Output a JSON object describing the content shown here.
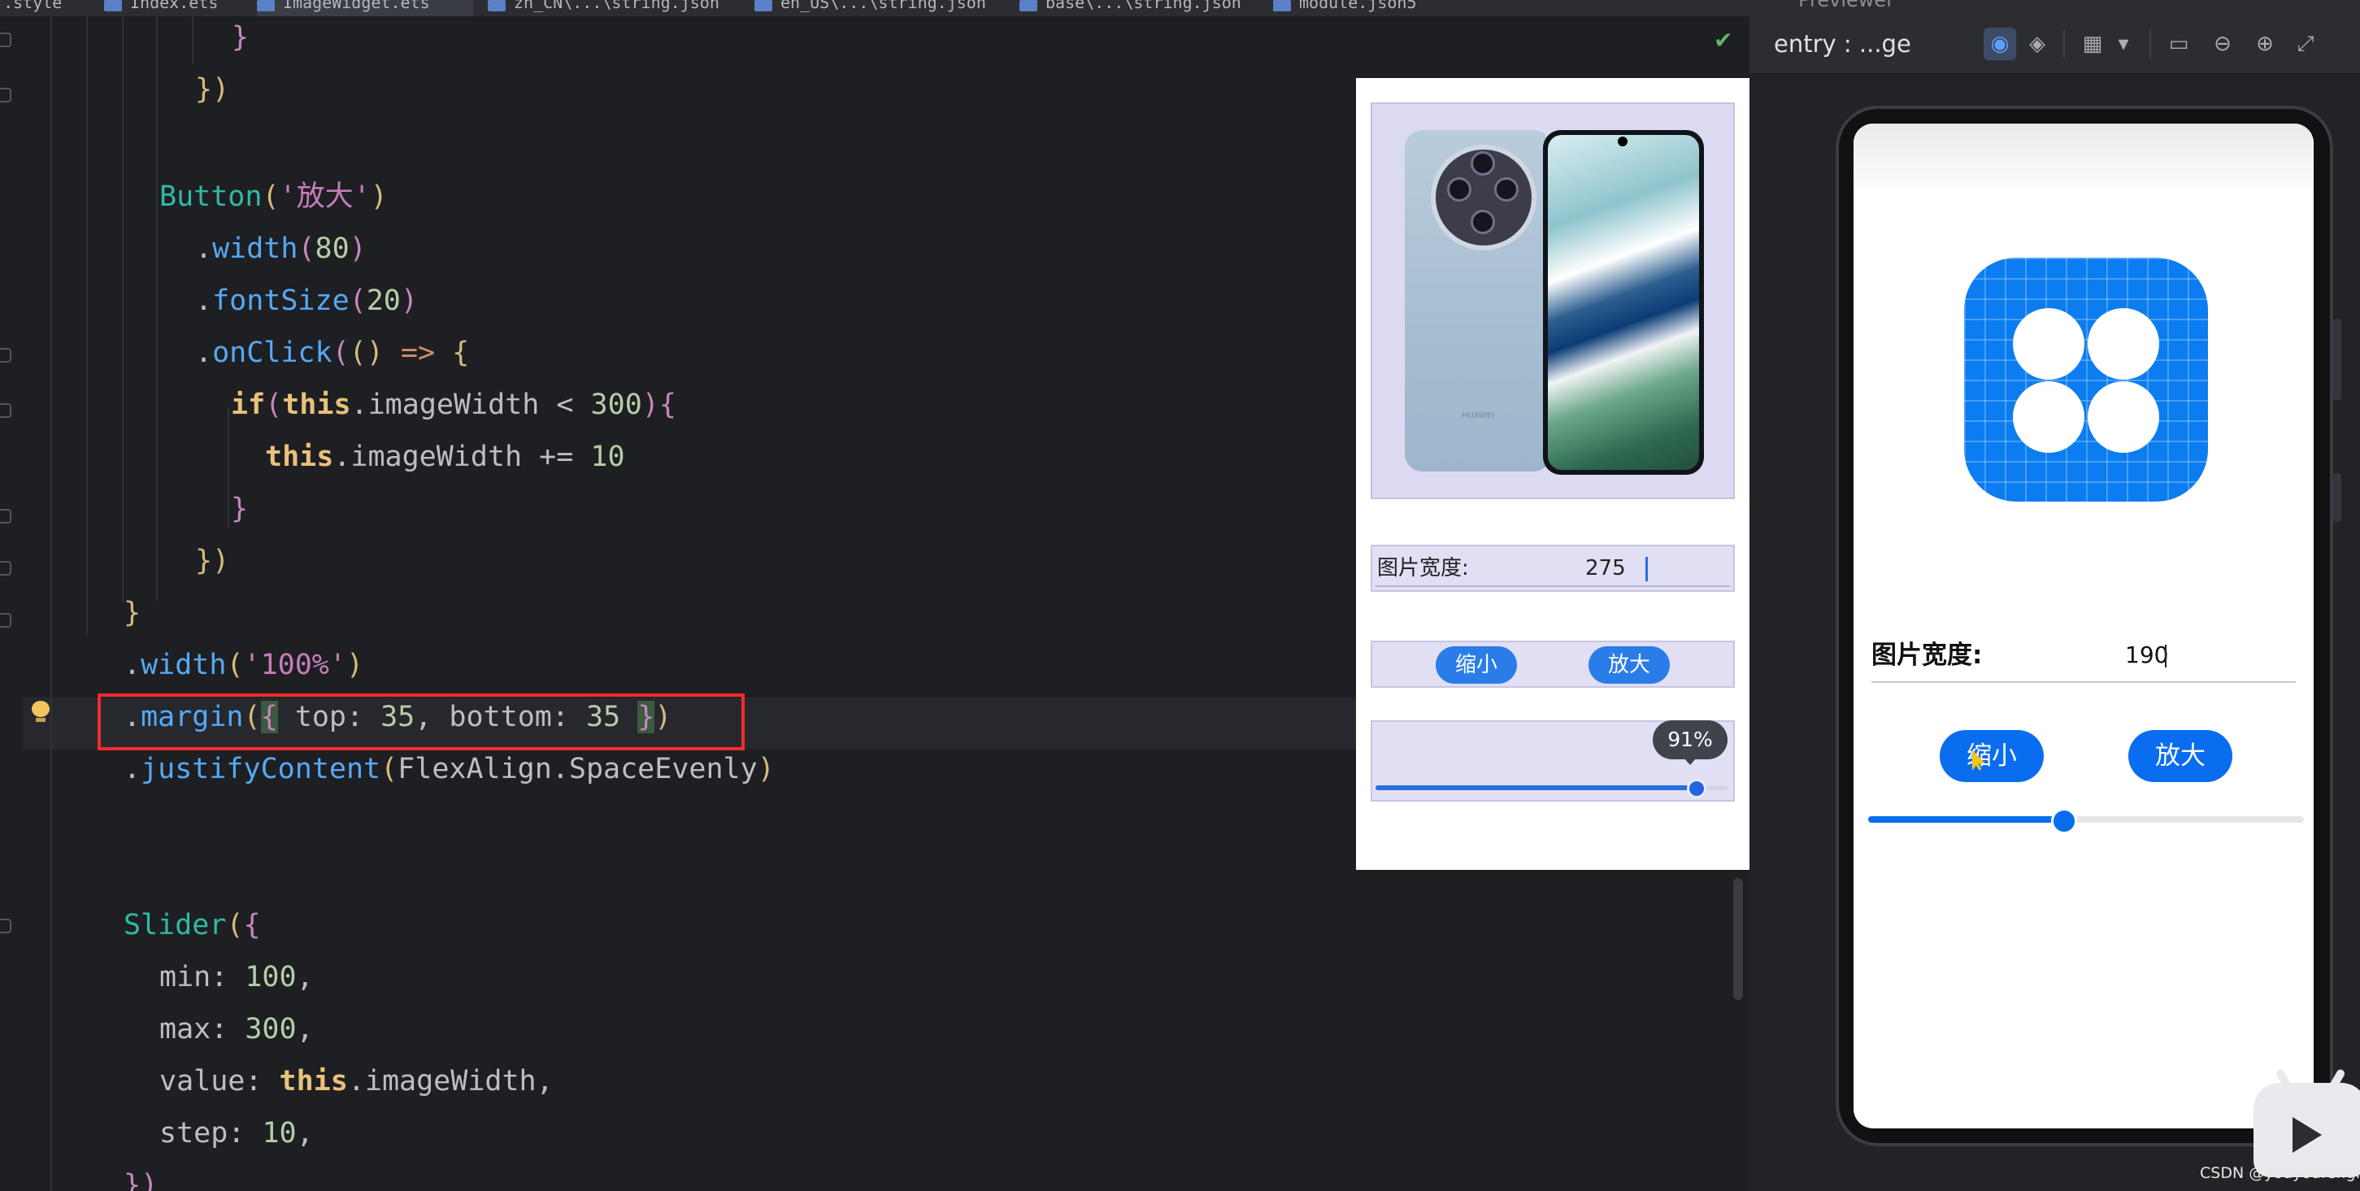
{
  "tabs": [
    "...style",
    "Index.ets",
    "ImageWidget.ets",
    "zh_CN\\...\\string.json",
    "en_US\\...\\string.json",
    "base\\...\\string.json",
    "module.json5"
  ],
  "preview_panel_title": "Previewer",
  "code": {
    "close_brace": "}",
    "close_paren_line": "})",
    "button_text": "'放大'",
    "width_80": "80",
    "fontsize_20": "20",
    "cond_value": "300",
    "inc_value": "10",
    "width_pct": "'100%'",
    "margin_top": "35",
    "margin_bottom": "35",
    "justify": "FlexAlign.SpaceEvenly",
    "slider_min": "100",
    "slider_max": "300",
    "slider_step": "10"
  },
  "inline_preview": {
    "image_brand_text": "HUAWEI",
    "width_label": "图片宽度:",
    "width_value": "275",
    "shrink_label": "缩小",
    "enlarge_label": "放大",
    "slider_tooltip": "91%",
    "slider_fraction": 0.91
  },
  "previewer": {
    "title": "entry : ...ge",
    "toolbar_icons": [
      "inspect-icon",
      "layers-icon",
      "grid-icon",
      "dropdown-icon",
      "crop-icon",
      "zoom-out-icon",
      "zoom-in-icon",
      "fit-icon"
    ],
    "device": {
      "width_label": "图片宽度:",
      "width_value": "190",
      "shrink_label": "缩小",
      "enlarge_label": "放大",
      "slider_fraction": 0.45
    }
  },
  "watermark": "CSDN @youyoufengfei",
  "colors": {
    "editor_bg": "#1e1f22",
    "accent_blue": "#0a6df0",
    "highlight_red": "#f62a2a",
    "app_icon_blue": "#0b7df0"
  }
}
